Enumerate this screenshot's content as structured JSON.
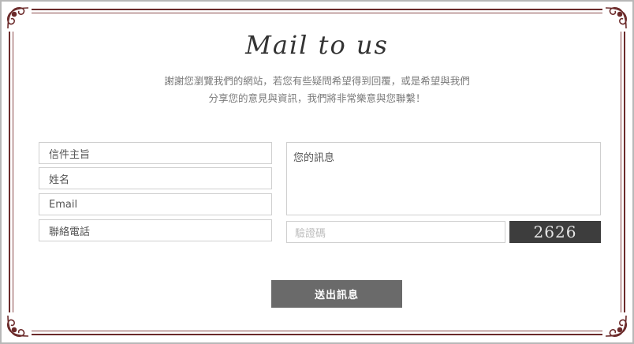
{
  "heading": "Mail to us",
  "intro": {
    "line1": "謝謝您瀏覽我們的網站，若您有些疑問希望得到回覆，或是希望與我們",
    "line2": "分享您的意見與資訊，我們將非常樂意與您聯繫！"
  },
  "form": {
    "subject_placeholder": "信件主旨",
    "name_placeholder": "姓名",
    "email_placeholder": "Email",
    "phone_placeholder": "聯絡電話",
    "message_placeholder": "您的訊息",
    "captcha_placeholder": "驗證碼",
    "captcha_code": "2626",
    "submit_label": "送出訊息"
  },
  "colors": {
    "frame": "#6b2a2a",
    "button": "#6a6a6a",
    "captcha_bg": "#3d3d3d"
  }
}
